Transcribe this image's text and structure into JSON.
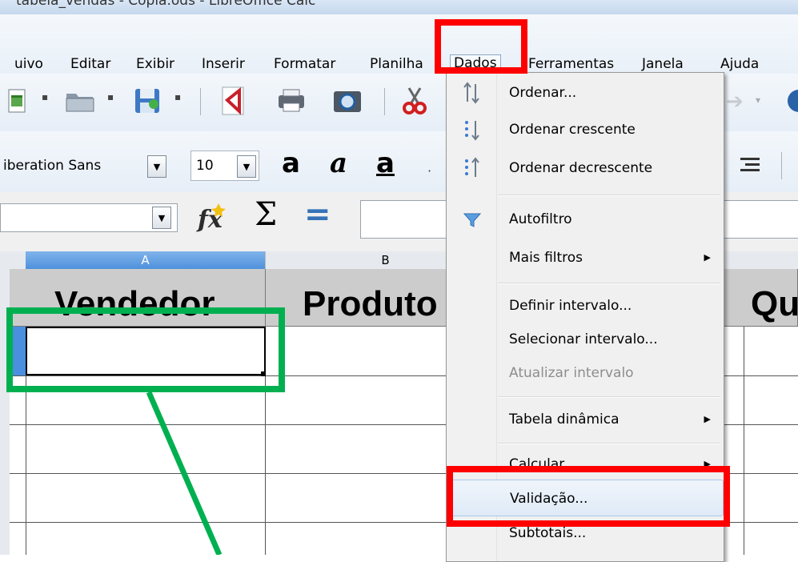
{
  "window": {
    "title": "tabela_vendas - Copia.ods - LibreOffice Calc"
  },
  "menubar": {
    "items": [
      {
        "label": "uivo"
      },
      {
        "label": "Editar"
      },
      {
        "label": "Exibir"
      },
      {
        "label": "Inserir"
      },
      {
        "label": "Formatar"
      },
      {
        "label": "Planilha"
      },
      {
        "label": "Dados"
      },
      {
        "label": "Ferramentas"
      },
      {
        "label": "Janela"
      },
      {
        "label": "Ajuda"
      }
    ]
  },
  "formatting": {
    "font_name": "iberation Sans",
    "font_size": "10"
  },
  "formula_bar": {
    "function_icon": "fx-icon",
    "sum_symbol": "Σ",
    "equals_symbol": "="
  },
  "sheet": {
    "columns": [
      "A",
      "B"
    ],
    "selected_column": "A",
    "header_row": [
      "Vendedor",
      "Produto",
      "Qu"
    ]
  },
  "dados_menu": {
    "items": [
      {
        "label": "Ordenar...",
        "icon": "sort-icon"
      },
      {
        "label": "Ordenar crescente",
        "icon": "sort-ascending-icon"
      },
      {
        "label": "Ordenar decrescente",
        "icon": "sort-descending-icon"
      },
      {
        "label": "Autofiltro",
        "icon": "autofilter-icon"
      },
      {
        "label": "Mais filtros"
      },
      {
        "label": "Definir intervalo..."
      },
      {
        "label": "Selecionar intervalo..."
      },
      {
        "label": "Atualizar intervalo",
        "disabled": true
      },
      {
        "label": "Tabela dinâmica"
      },
      {
        "label": "Calcular"
      },
      {
        "label": "Validação..."
      },
      {
        "label": "Subtotais..."
      }
    ]
  },
  "annotations": {
    "highlight_color": "#ff0000",
    "cell_highlight_color": "#00b050"
  }
}
